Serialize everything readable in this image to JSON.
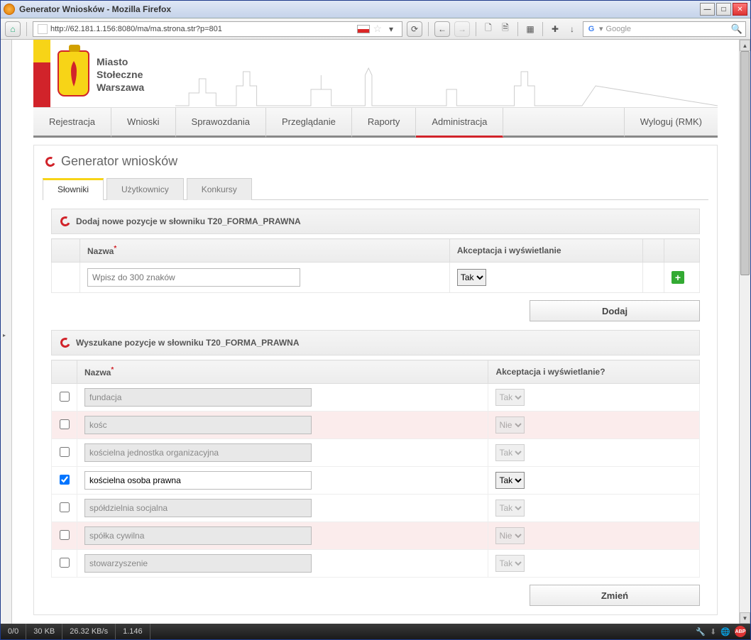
{
  "window": {
    "title": "Generator Wniosków - Mozilla Firefox"
  },
  "url": "http://62.181.1.156:8080/ma/ma.strona.str?p=801",
  "search": {
    "placeholder": "Google"
  },
  "brand": {
    "line1": "Miasto",
    "line2": "Stołeczne",
    "line3": "Warszawa"
  },
  "nav": {
    "items": [
      "Rejestracja",
      "Wnioski",
      "Sprawozdania",
      "Przeglądanie",
      "Raporty",
      "Administracja"
    ],
    "active_index": 5,
    "logout": "Wyloguj (RMK)"
  },
  "panel_title": "Generator wniosków",
  "tabs": {
    "items": [
      "Słowniki",
      "Użytkownicy",
      "Konkursy"
    ],
    "active_index": 0
  },
  "add_section": {
    "title": "Dodaj nowe pozycje w słowniku T20_FORMA_PRAWNA",
    "col_name": "Nazwa",
    "col_accept": "Akceptacja i wyświetlanie",
    "name_placeholder": "Wpisz do 300 znaków",
    "accept_value": "Tak",
    "button": "Dodaj"
  },
  "list_section": {
    "title": "Wyszukane pozycje w słowniku T20_FORMA_PRAWNA",
    "col_name": "Nazwa",
    "col_accept": "Akceptacja i wyświetlanie?",
    "rows": [
      {
        "checked": false,
        "name": "fundacja",
        "accept": "Tak",
        "editable": false,
        "pink": false
      },
      {
        "checked": false,
        "name": "kośc",
        "accept": "Nie",
        "editable": false,
        "pink": true
      },
      {
        "checked": false,
        "name": "kościelna jednostka organizacyjna",
        "accept": "Tak",
        "editable": false,
        "pink": false
      },
      {
        "checked": true,
        "name": "kościelna osoba prawna",
        "accept": "Tak",
        "editable": true,
        "pink": false
      },
      {
        "checked": false,
        "name": "spółdzielnia socjalna",
        "accept": "Tak",
        "editable": false,
        "pink": false
      },
      {
        "checked": false,
        "name": "spółka cywilna",
        "accept": "Nie",
        "editable": false,
        "pink": true
      },
      {
        "checked": false,
        "name": "stowarzyszenie",
        "accept": "Tak",
        "editable": false,
        "pink": false
      }
    ],
    "button": "Zmień"
  },
  "status": {
    "left1": "0/0",
    "left2": "30 KB",
    "left3": "26.32 KB/s",
    "left4": "1.146"
  }
}
